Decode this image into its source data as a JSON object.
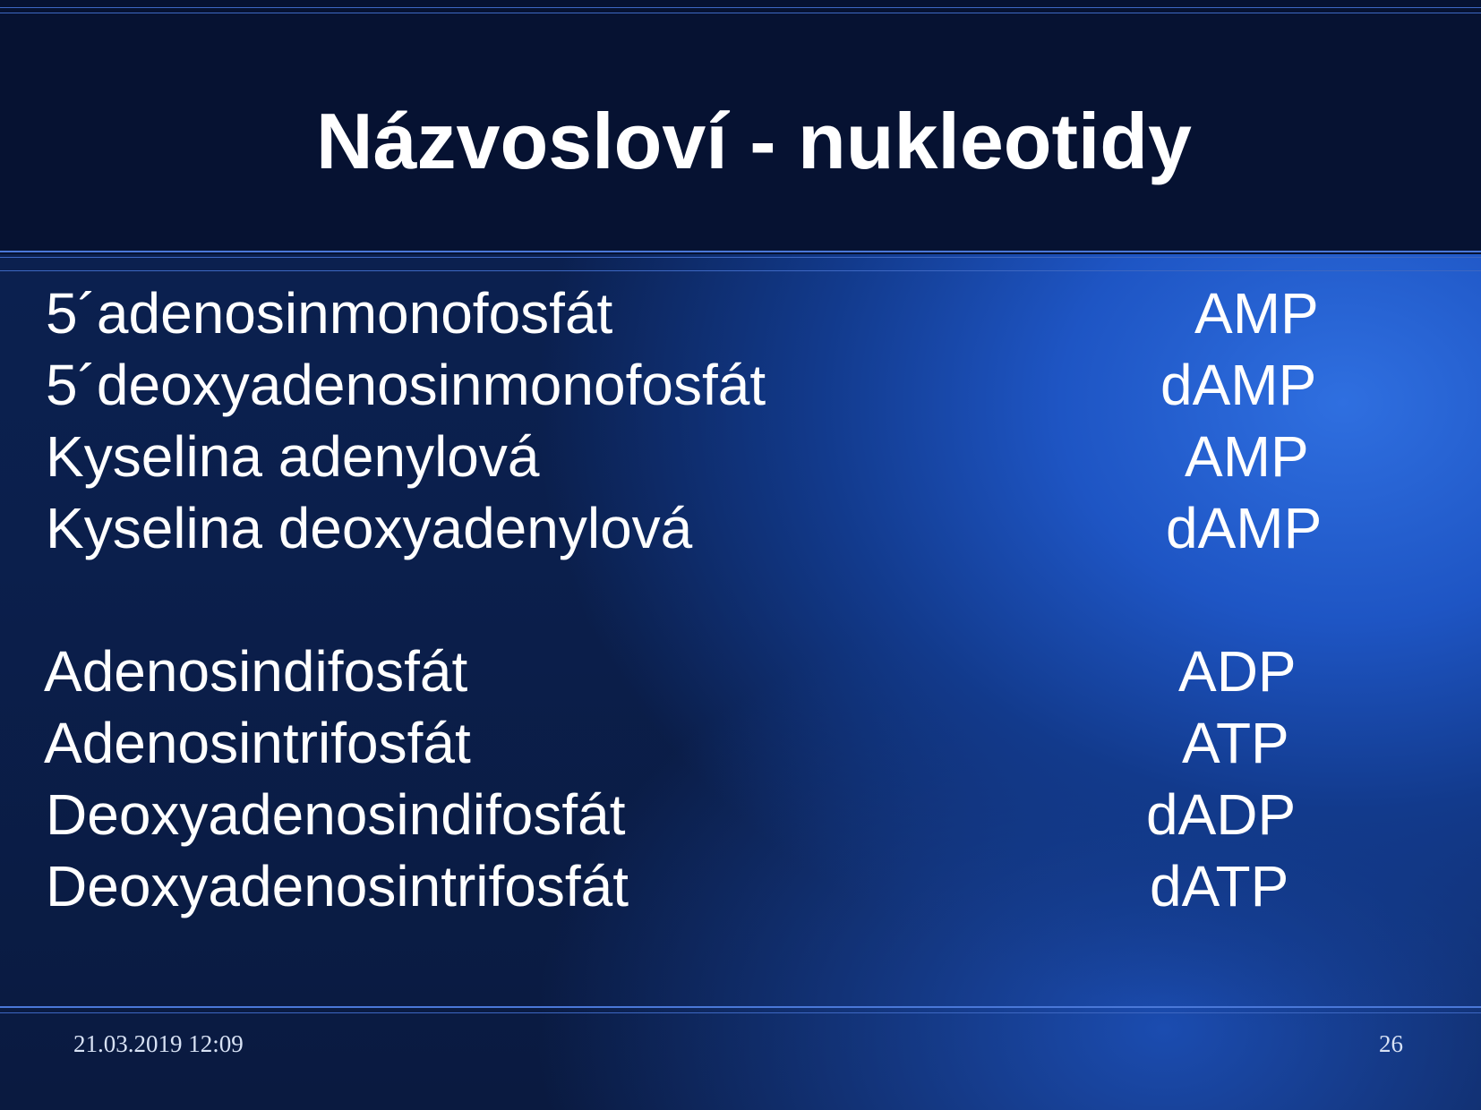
{
  "slide": {
    "title": "Názvosloví - nukleotidy",
    "entries": [
      {
        "name": "5´adenosinmonofosfát",
        "abbr": "AMP"
      },
      {
        "name": "5´deoxyadenosinmonofosfát",
        "abbr": "dAMP"
      },
      {
        "name": "Kyselina adenylová",
        "abbr": "AMP"
      },
      {
        "name": "Kyselina deoxyadenylová",
        "abbr": "dAMP"
      },
      {
        "name": "Adenosindifosfát",
        "abbr": "ADP"
      },
      {
        "name": "Adenosintrifosfát",
        "abbr": "ATP"
      },
      {
        "name": "Deoxyadenosindifosfát",
        "abbr": "dADP"
      },
      {
        "name": "Deoxyadenosintrifosfát",
        "abbr": "dATP"
      }
    ],
    "footer": {
      "datetime": "21.03.2019 12:09",
      "page_number": "26"
    }
  },
  "colors": {
    "title_bar": "#061232",
    "accent_line": "#4a78d8",
    "text": "#ffffff"
  }
}
